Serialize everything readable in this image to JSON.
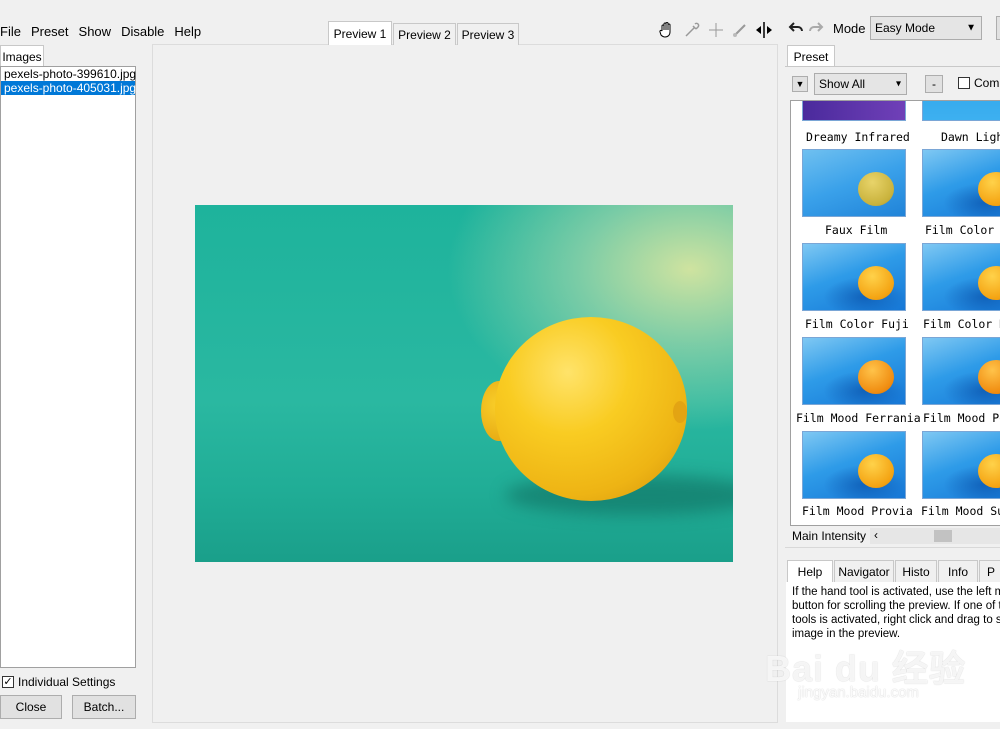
{
  "menu": [
    "File",
    "Preset",
    "Show",
    "Disable",
    "Help"
  ],
  "left_panel": {
    "tab_label": "Images",
    "files": [
      "pexels-photo-399610.jpg",
      "pexels-photo-405031.jpg"
    ],
    "selected_index": 1,
    "individual_settings_label": "Individual Settings",
    "individual_settings_checked": true,
    "close_label": "Close",
    "batch_label": "Batch..."
  },
  "preview_tabs": [
    "Preview 1",
    "Preview 2",
    "Preview 3"
  ],
  "toolbar": {
    "icons": [
      "hand-icon",
      "eyedropper-icon",
      "crosshair-icon",
      "brush-icon",
      "split-icon"
    ]
  },
  "right_panel": {
    "mode_label": "Mode",
    "mode_value": "Easy Mode",
    "preset_tab": "Preset",
    "filter_value": "Show All",
    "minus_label": "-",
    "combine_label": "Comb",
    "presets": [
      {
        "name": "Dreamy Infrared",
        "style": "top"
      },
      {
        "name": "Dawn Ligh",
        "style": "top2"
      },
      {
        "name": "Faux Film",
        "style": "faux"
      },
      {
        "name": "Film Color A",
        "style": ""
      },
      {
        "name": "Film Color Fuji",
        "style": ""
      },
      {
        "name": "Film Color K",
        "style": ""
      },
      {
        "name": "Film Mood Ferrania",
        "style": "mood"
      },
      {
        "name": "Film Mood Po",
        "style": "mood"
      },
      {
        "name": "Film Mood Provia",
        "style": ""
      },
      {
        "name": "Film Mood Sup",
        "style": ""
      }
    ],
    "main_intensity_label": "Main Intensity",
    "bottom_tabs": [
      "Help",
      "Navigator",
      "Histo",
      "Info",
      "P"
    ],
    "help_lines": [
      "If the hand tool is activated, use the left m",
      "button for scrolling the preview. If one of t",
      "tools is activated, right click and drag to s",
      "image in the preview."
    ]
  },
  "watermark": {
    "main": "Bai du 经验",
    "sub": "jingyan.baidu.com"
  }
}
